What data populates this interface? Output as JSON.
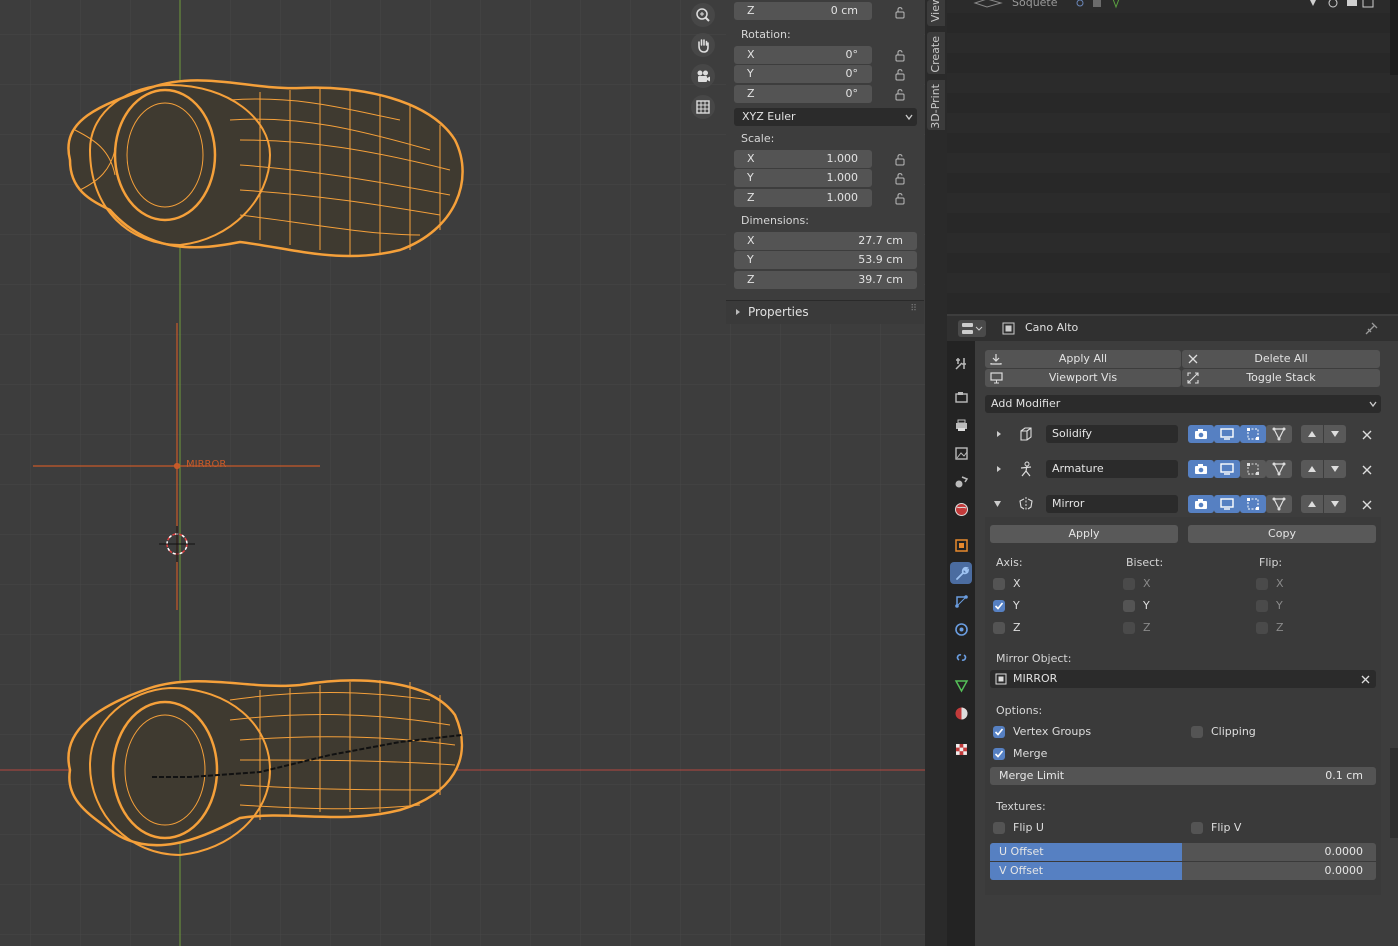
{
  "viewport": {
    "empty_label": "MIRROR",
    "nav_icons": [
      "zoom-icon",
      "hand-pan-icon",
      "camera-icon",
      "grid-icon"
    ]
  },
  "npanel": {
    "location_z": {
      "axis": "Z",
      "value": "0 cm"
    },
    "rotation_label": "Rotation:",
    "rotation": [
      {
        "axis": "X",
        "value": "0°"
      },
      {
        "axis": "Y",
        "value": "0°"
      },
      {
        "axis": "Z",
        "value": "0°"
      }
    ],
    "rotation_mode": "XYZ Euler",
    "scale_label": "Scale:",
    "scale": [
      {
        "axis": "X",
        "value": "1.000"
      },
      {
        "axis": "Y",
        "value": "1.000"
      },
      {
        "axis": "Z",
        "value": "1.000"
      }
    ],
    "dimensions_label": "Dimensions:",
    "dimensions": [
      {
        "axis": "X",
        "value": "27.7 cm"
      },
      {
        "axis": "Y",
        "value": "53.9 cm"
      },
      {
        "axis": "Z",
        "value": "39.7 cm"
      }
    ],
    "properties_label": "Properties"
  },
  "vtabs": {
    "view": "View",
    "create": "Create",
    "print3d": "3D-Print"
  },
  "outliner": {
    "top_item": "Soquete"
  },
  "properties": {
    "object_name": "Cano Alto",
    "apply_all": "Apply All",
    "delete_all": "Delete All",
    "viewport_vis": "Viewport Vis",
    "toggle_stack": "Toggle Stack",
    "add_modifier": "Add Modifier",
    "modifiers": [
      {
        "name": "Solidify",
        "expanded": false
      },
      {
        "name": "Armature",
        "expanded": false
      },
      {
        "name": "Mirror",
        "expanded": true
      }
    ],
    "mirror": {
      "apply": "Apply",
      "copy": "Copy",
      "axis_label": "Axis:",
      "bisect_label": "Bisect:",
      "flip_label": "Flip:",
      "axis": {
        "x": "X",
        "y": "Y",
        "z": "Z"
      },
      "mirror_object_label": "Mirror Object:",
      "mirror_object": "MIRROR",
      "options_label": "Options:",
      "vertex_groups": "Vertex Groups",
      "clipping": "Clipping",
      "merge": "Merge",
      "merge_limit_label": "Merge Limit",
      "merge_limit": "0.1 cm",
      "textures_label": "Textures:",
      "flip_u": "Flip U",
      "flip_v": "Flip V",
      "u_offset_label": "U Offset",
      "u_offset": "0.0000",
      "v_offset_label": "V Offset",
      "v_offset": "0.0000"
    }
  },
  "colors": {
    "accent": "#5680c2",
    "wire": "#f5a03a",
    "x_axis": "#b5473f",
    "y_axis": "#6f9a3a"
  }
}
